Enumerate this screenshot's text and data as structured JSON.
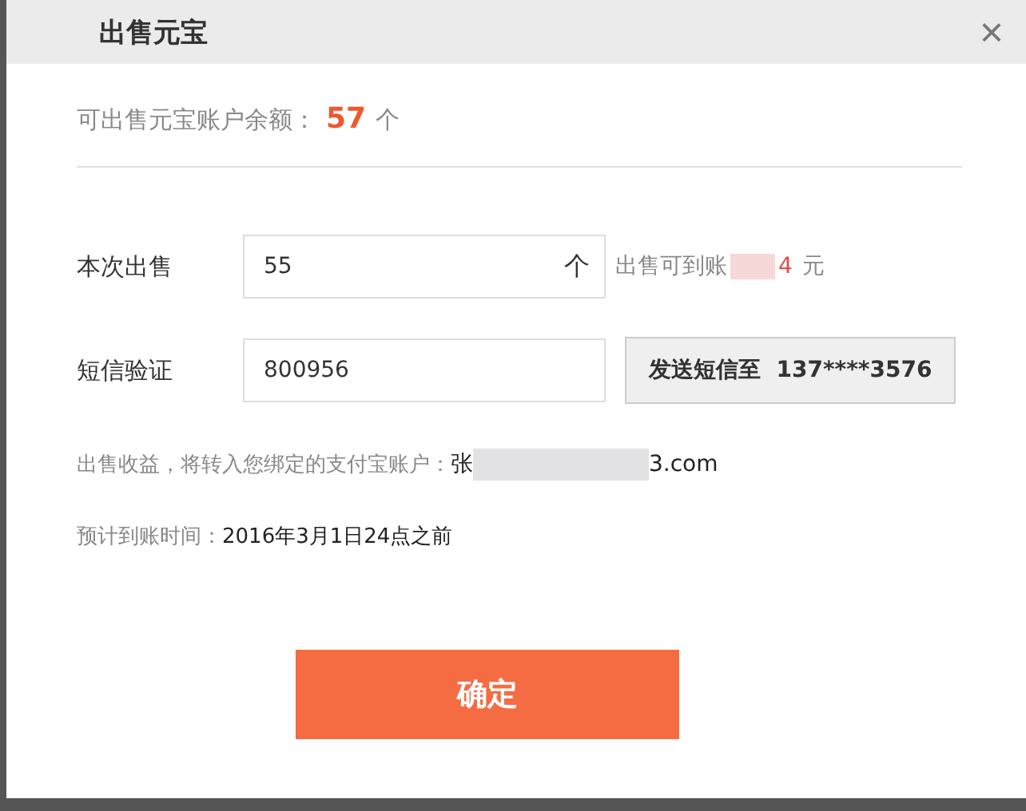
{
  "dialog": {
    "title": "出售元宝",
    "close": "×"
  },
  "balance": {
    "label": "可出售元宝账户余额：",
    "amount": "57",
    "unit": "个"
  },
  "form": [
    {
      "kind": "quantity",
      "label": "本次出售",
      "value": "55",
      "unit": "个",
      "note_prefix": "出售可到账",
      "note_tail": "4",
      "note_unit": "元"
    },
    {
      "kind": "sms",
      "label": "短信验证",
      "value": "800956",
      "button": "发送短信至  137****3576"
    }
  ],
  "payout": {
    "label": "出售收益，将转入您绑定的支付宝账户：",
    "account_start": "张",
    "account_end": "3.com"
  },
  "eta": {
    "label": "预计到账时间：",
    "value": "2016年3月1日24点之前"
  },
  "confirm_button": "确定"
}
